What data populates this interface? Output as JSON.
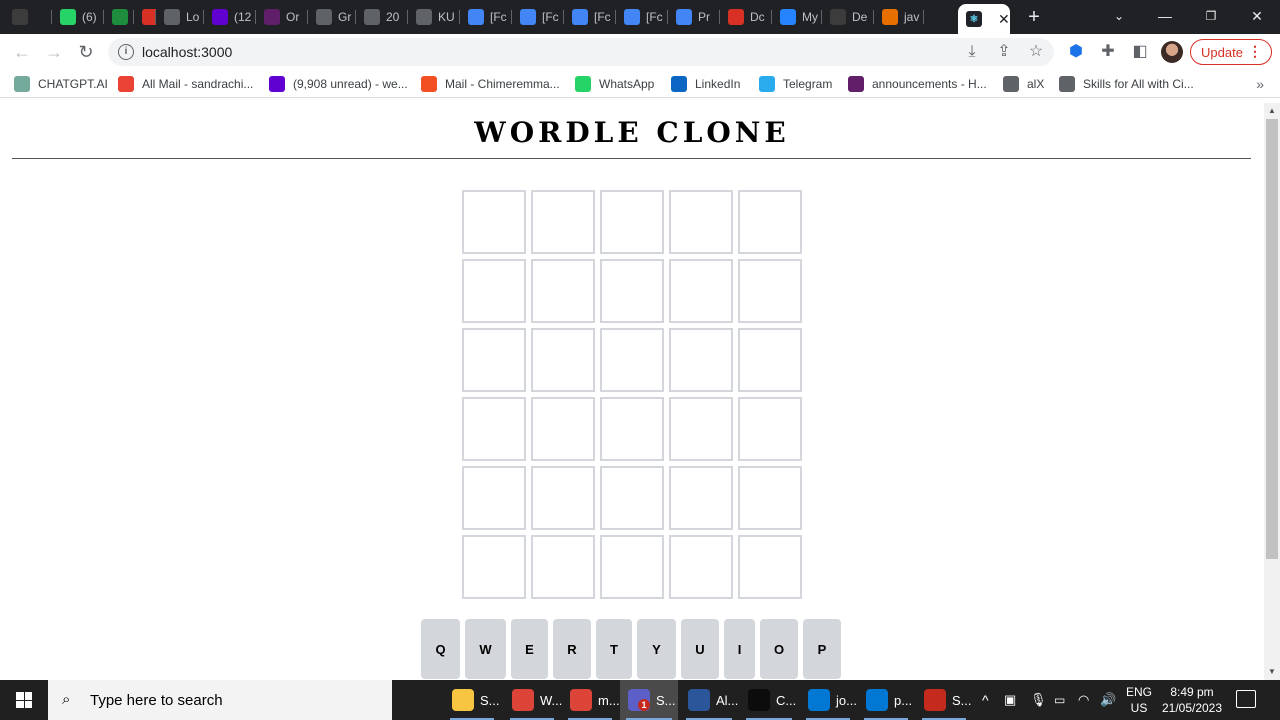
{
  "browser": {
    "tabs": [
      {
        "label": "",
        "icon": "chatgpt-icon",
        "color": "#3c3c3c"
      },
      {
        "label": "(6)",
        "icon": "whatsapp-icon",
        "color": "#25d366"
      },
      {
        "label": "",
        "icon": "google-meet-icon",
        "color": "#1e8e3e"
      },
      {
        "label": "",
        "icon": "record-icon",
        "color": "#d93025"
      },
      {
        "label": "Lo",
        "icon": "alx-icon",
        "color": "#5f6368"
      },
      {
        "label": "(12",
        "icon": "yahoo-mail-icon",
        "color": "#6001d2"
      },
      {
        "label": "Or",
        "icon": "slack-icon",
        "color": "#611f69"
      },
      {
        "label": "Gr",
        "icon": "loading-icon",
        "color": "#5f6368"
      },
      {
        "label": "20",
        "icon": "loading-icon",
        "color": "#5f6368"
      },
      {
        "label": "KU",
        "icon": "loading-icon",
        "color": "#5f6368"
      },
      {
        "label": "[Fc",
        "icon": "google-docs-icon",
        "color": "#4285f4"
      },
      {
        "label": "[Fc",
        "icon": "google-docs-icon",
        "color": "#4285f4"
      },
      {
        "label": "[Fc",
        "icon": "google-docs-icon",
        "color": "#4285f4"
      },
      {
        "label": "[Fc",
        "icon": "google-docs-icon",
        "color": "#4285f4"
      },
      {
        "label": "Pr",
        "icon": "google-docs-icon",
        "color": "#4285f4"
      },
      {
        "label": "Dc",
        "icon": "heart-icon",
        "color": "#d93025"
      },
      {
        "label": "My",
        "icon": "atlassian-icon",
        "color": "#2684ff"
      },
      {
        "label": "De",
        "icon": "github-icon",
        "color": "#3c3c3c"
      },
      {
        "label": "jav",
        "icon": "java-icon",
        "color": "#e76f00"
      }
    ],
    "active_tab": {
      "label": "",
      "icon": "react-icon"
    },
    "url": "localhost:3000",
    "update_label": "Update",
    "bookmarks": [
      {
        "label": "CHATGPT.AI",
        "icon": "chatgpt-icon",
        "color": "#74aa9c"
      },
      {
        "label": "All Mail - sandrachi...",
        "icon": "gmail-icon",
        "color": "#ea4335"
      },
      {
        "label": "(9,908 unread) - we...",
        "icon": "yahoo-mail-icon",
        "color": "#6001d2"
      },
      {
        "label": "Mail - Chimeremma...",
        "icon": "microsoft-icon",
        "color": "#f25022"
      },
      {
        "label": "WhatsApp",
        "icon": "whatsapp-icon",
        "color": "#25d366"
      },
      {
        "label": "LinkedIn",
        "icon": "linkedin-icon",
        "color": "#0a66c2"
      },
      {
        "label": "Telegram",
        "icon": "telegram-icon",
        "color": "#2aabee"
      },
      {
        "label": "announcements - H...",
        "icon": "slack-icon",
        "color": "#611f69"
      },
      {
        "label": "alX",
        "icon": "alx-icon",
        "color": "#5f6368"
      },
      {
        "label": "Skills for All with Ci...",
        "icon": "cisco-icon",
        "color": "#5f6368"
      }
    ]
  },
  "game": {
    "title": "WORDLE CLONE",
    "rows": 6,
    "cols": 5,
    "keyboard_row1": [
      "Q",
      "W",
      "E",
      "R",
      "T",
      "Y",
      "U",
      "I",
      "O",
      "P"
    ],
    "key_color": "#d3d6da",
    "tile_border_color": "#d3d6da"
  },
  "taskbar": {
    "search_placeholder": "Type here to search",
    "apps": [
      {
        "label": "",
        "icon": "task-view-icon",
        "color": "#202020"
      },
      {
        "label": "S...",
        "icon": "file-explorer-icon",
        "color": "#f8c542"
      },
      {
        "label": "W...",
        "icon": "chrome-icon",
        "color": "#db4437"
      },
      {
        "label": "m...",
        "icon": "chrome-icon",
        "color": "#db4437"
      },
      {
        "label": "S...",
        "icon": "teams-icon",
        "color": "#5b5fc7"
      },
      {
        "label": "Al...",
        "icon": "word-icon",
        "color": "#2b579a"
      },
      {
        "label": "C...",
        "icon": "terminal-icon",
        "color": "#0c0c0c"
      },
      {
        "label": "jo...",
        "icon": "vscode-icon",
        "color": "#0078d4"
      },
      {
        "label": "p...",
        "icon": "vscode-icon",
        "color": "#0078d4"
      },
      {
        "label": "S...",
        "icon": "snipping-tool-icon",
        "color": "#c42b1c"
      }
    ],
    "teams_badge": "1",
    "language_top": "ENG",
    "language_bottom": "US",
    "time": "8:49 pm",
    "date": "21/05/2023"
  }
}
